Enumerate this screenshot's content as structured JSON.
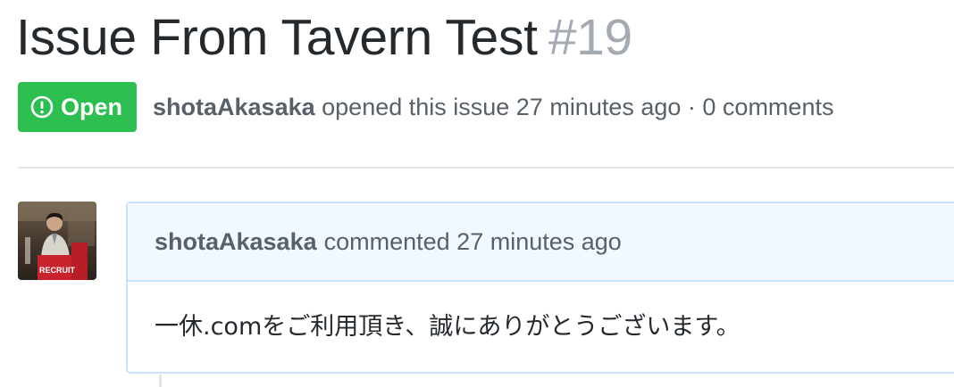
{
  "issue": {
    "title": "Issue From Tavern Test",
    "number": "#19",
    "state": "Open",
    "state_color": "#2cbe4e",
    "state_icon": "issue-opened-icon",
    "author": "shotaAkasaka",
    "opened_text": "opened this issue 27 minutes ago · 0 comments"
  },
  "comment": {
    "author": "shotaAkasaka",
    "action_text": "commented 27 minutes ago",
    "body": "一休.comをご利用頂き、誠にありがとうございます。",
    "header_bg": "#f1f8ff",
    "border_color": "#c8e1ff",
    "avatar_caption": "RECRUIT"
  }
}
